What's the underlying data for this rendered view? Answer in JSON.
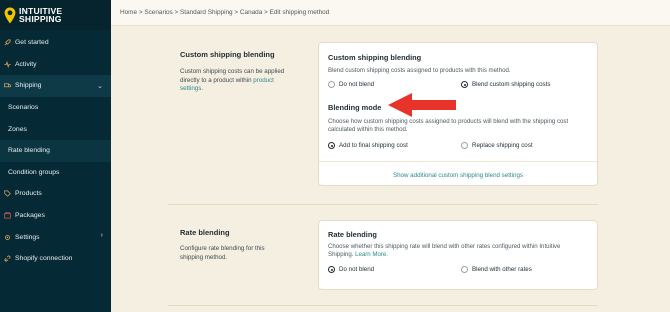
{
  "brand": {
    "line1": "INTUITIVE",
    "line2": "SHIPPING"
  },
  "sidebar": {
    "items": [
      {
        "label": "Get started"
      },
      {
        "label": "Activity"
      },
      {
        "label": "Shipping"
      },
      {
        "label": "Scenarios"
      },
      {
        "label": "Zones"
      },
      {
        "label": "Rate blending"
      },
      {
        "label": "Condition groups"
      },
      {
        "label": "Products"
      },
      {
        "label": "Packages"
      },
      {
        "label": "Settings"
      },
      {
        "label": "Shopify connection"
      }
    ]
  },
  "breadcrumb": "Home > Scenarios > Standard Shipping > Canada > Edit shipping method",
  "custom_blending": {
    "section_title": "Custom shipping blending",
    "section_desc": "Custom shipping costs can be applied directly to a product within ",
    "section_link": "product settings",
    "section_desc_end": ".",
    "card_title": "Custom shipping blending",
    "card_text": "Blend custom shipping costs assigned to products with this method.",
    "opt_no": "Do not blend",
    "opt_yes": "Blend custom shipping costs",
    "mode_title": "Blending mode",
    "mode_text": "Choose how custom shipping costs assigned to products will blend with the shipping cost calculated within this method.",
    "mode_add": "Add to final shipping cost",
    "mode_replace": "Replace shipping cost",
    "show_more": "Show additional custom shipping blend settings"
  },
  "rate_blending": {
    "section_title": "Rate blending",
    "section_desc": "Configure rate blending for this shipping method.",
    "card_title": "Rate blending",
    "card_text": "Choose whether this shipping rate will blend with other rates configured within Intuitive Shipping. ",
    "learn_more": "Learn More.",
    "opt_no": "Do not blend",
    "opt_yes": "Blend with other rates"
  },
  "colors": {
    "sidebar": "#062a35",
    "accent": "#2b8a8b",
    "arrow": "#e8332a",
    "background": "#f5efe1"
  }
}
